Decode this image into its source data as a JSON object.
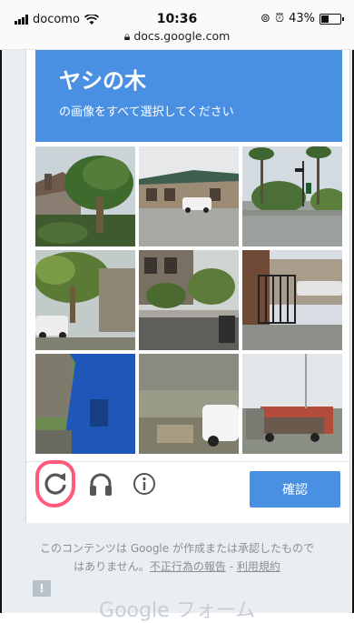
{
  "status_bar": {
    "carrier": "docomo",
    "time": "10:36",
    "url": "docs.google.com",
    "battery": "43%"
  },
  "captcha": {
    "title": "ヤシの木",
    "instruction": "の画像をすべて選択してください",
    "verify_label": "確認"
  },
  "footer": {
    "disclaimer_line1": "このコンテンツは Google が作成または承認したもので",
    "disclaimer_line2_prefix": "はありません。",
    "report_link": "不正行為の報告",
    "separator": " - ",
    "terms_link": "利用規約",
    "brand": "Google フォーム"
  },
  "colors": {
    "accent": "#4a90e2",
    "highlight": "#ff5a7a"
  }
}
